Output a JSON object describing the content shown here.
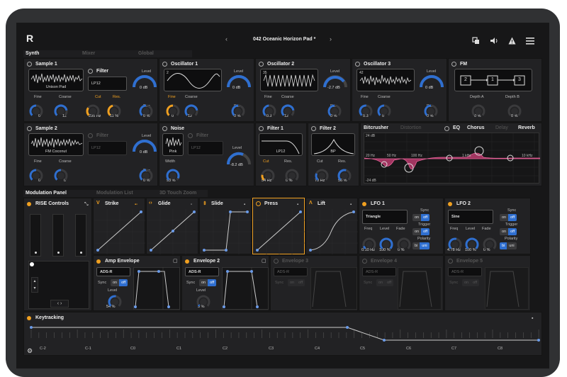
{
  "header": {
    "logo": "R",
    "preset": "042 Oceanic Horizon Pad *",
    "prev": "‹",
    "next": "›"
  },
  "tabs": [
    "Synth",
    "Mixer",
    "Global"
  ],
  "sample1": {
    "title": "Sample 1",
    "wave": "Unison Pad",
    "filter": "Filter",
    "filter_type": "LP12",
    "level_label": "Level",
    "level": "0 dB",
    "fine_label": "Fine",
    "fine": "0",
    "coarse_label": "Coarse",
    "coarse": "12",
    "cut_label": "Cut",
    "cut": "235 Hz",
    "res_label": "Res.",
    "res": "11 %",
    "pan_label": "Pan",
    "pan": "0 %"
  },
  "osc1": {
    "title": "Oscillator 1",
    "num": "2",
    "level_label": "Level",
    "level": "0 dB",
    "fine_label": "Fine",
    "fine": "0",
    "coarse_label": "Coarse",
    "coarse": "12",
    "pan_label": "Pan",
    "pan": "0 %"
  },
  "osc2": {
    "title": "Oscillator 2",
    "num": "35",
    "level_label": "Level",
    "level": "-2.7 dB",
    "fine_label": "Fine",
    "fine": "-0.3",
    "coarse_label": "Coarse",
    "coarse": "12",
    "pan_label": "Pan",
    "pan": "0 %"
  },
  "osc3": {
    "title": "Oscillator 3",
    "num": "42",
    "level_label": "Level",
    "level": "0 dB",
    "fine_label": "Fine",
    "fine": "0.3",
    "coarse_label": "Coarse",
    "coarse": "0",
    "pan_label": "Pan",
    "pan": "0 %"
  },
  "fm": {
    "title": "FM",
    "n1": "2",
    "n2": "1",
    "n3": "3",
    "depth_a_label": "Depth A",
    "depth_a": "0 %",
    "depth_b_label": "Depth B",
    "depth_b": "0 %"
  },
  "sample2": {
    "title": "Sample 2",
    "wave": "FM Coconut",
    "filter": "Filter",
    "filter_type": "LP12",
    "level_label": "Level",
    "level": "0 dB",
    "fine_label": "Fine",
    "fine": "0",
    "coarse_label": "Coarse",
    "coarse": "0",
    "pan_label": "Pan",
    "pan": "0 %"
  },
  "noise": {
    "title": "Noise",
    "wave": "Pink",
    "filter": "Filter",
    "filter_type": "LP12",
    "level_label": "Level",
    "level": "-8.2 dB",
    "width_label": "Width",
    "width": "93 %"
  },
  "filter1": {
    "title": "Filter 1",
    "type": "LP12",
    "cut_label": "Cut",
    "cut": "54 Hz",
    "res_label": "Res.",
    "res": "0 %"
  },
  "filter2": {
    "title": "Filter 2",
    "type": "BP",
    "cut_label": "Cut",
    "cut": "70 Hz",
    "res_label": "Res.",
    "res": "56 %"
  },
  "fx": {
    "tabs": [
      "Bitcrusher",
      "Distortion",
      "EQ",
      "Chorus",
      "Delay",
      "Reverb"
    ],
    "db_top": "24 dB",
    "db_bottom": "-24 dB",
    "f1": "20 Hz",
    "f2": "50 Hz",
    "f3": "100 Hz",
    "f4": "1 kHz",
    "f5": "10 kHz"
  },
  "mod_tabs": [
    "Modulation Panel",
    "Modulation List",
    "3D Touch Zoom"
  ],
  "rise": {
    "title": "RISE Controls"
  },
  "curves": [
    "Strike",
    "Glide",
    "Slide",
    "Press",
    "Lift"
  ],
  "curve_icons": [
    "V",
    "‹›",
    "⇕",
    "",
    ""
  ],
  "lfo1": {
    "title": "LFO 1",
    "shape": "Triangle",
    "sync_label": "Sync",
    "on": "on",
    "off": "off",
    "trigger_label": "Trigger",
    "polarity_label": "Polarity",
    "bi": "bi",
    "uni": "uni",
    "freq_label": "Freq",
    "freq": "0.10 Hz",
    "level_label": "Level",
    "level": "100 %",
    "fade_label": "Fade",
    "fade": "0 %"
  },
  "lfo2": {
    "title": "LFO 2",
    "shape": "Sine",
    "sync_label": "Sync",
    "on": "on",
    "off": "off",
    "trigger_label": "Trigger",
    "polarity_label": "Polarity",
    "bi": "bi",
    "uni": "uni",
    "freq_label": "Freq",
    "freq": "4.78 Hz",
    "level_label": "Level",
    "level": "100 %",
    "fade_label": "Fade",
    "fade": "0 %"
  },
  "amp_env": {
    "title": "Amp Envelope",
    "type": "ADS-R",
    "sync_label": "Sync",
    "on": "on",
    "off": "off",
    "level_label": "Level",
    "level": "54 %"
  },
  "env2": {
    "title": "Envelope 2",
    "type": "ADS-R",
    "sync_label": "Sync",
    "on": "on",
    "off": "off",
    "level_label": "Level",
    "level": "5 %"
  },
  "env3": {
    "title": "Envelope 3",
    "type": "ADS-R",
    "sync_label": "Sync",
    "on": "on",
    "off": "off"
  },
  "env4": {
    "title": "Envelope 4",
    "type": "ADS-R",
    "sync_label": "Sync",
    "on": "on",
    "off": "off"
  },
  "env5": {
    "title": "Envelope 5",
    "type": "ADS-R",
    "sync_label": "Sync",
    "on": "on",
    "off": "off"
  },
  "keytracking": {
    "title": "Keytracking",
    "notes": [
      "C-2",
      "C-1",
      "C0",
      "C1",
      "C2",
      "C3",
      "C4",
      "C5",
      "C6",
      "C7",
      "C8"
    ]
  },
  "colors": {
    "accent_orange": "#f0a020",
    "accent_blue": "#2f6fd0",
    "eq_pink": "#d0407a"
  }
}
